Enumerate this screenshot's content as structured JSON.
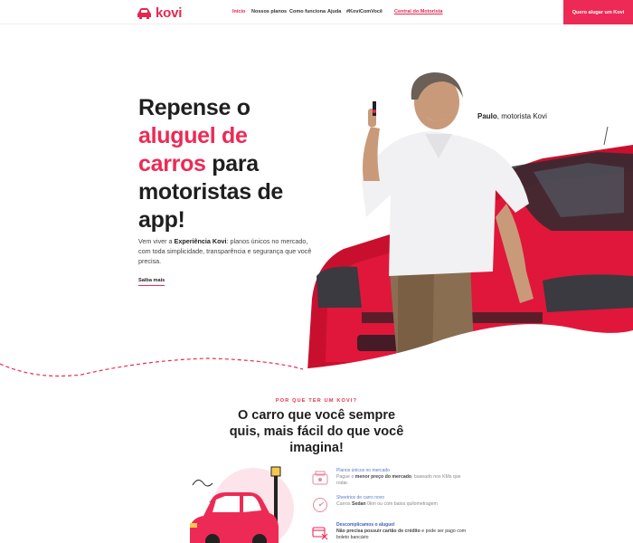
{
  "header": {
    "logo_text": "kovi",
    "nav": {
      "home": "Início",
      "plans": "Nossos planos",
      "how": "Como funciona",
      "help": "Ajuda",
      "hashtag": "#KoviComVocê",
      "central": "Central do Motorista"
    },
    "cta": "Quero alugar um Kovi"
  },
  "hero": {
    "title_line1": "Repense o",
    "title_accent": "aluguel de carros",
    "title_rest": "para motoristas de app!",
    "desc_pre": "Vem viver a ",
    "desc_bold": "Experiência Kovi",
    "desc_post": ": planos únicos no mercado, com toda simplicidade, transparência e segurança que você precisa.",
    "more": "Saiba mais",
    "caption_name": "Paulo",
    "caption_role": ", motorista Kovi"
  },
  "section": {
    "eyebrow": "POR QUE TER UM KOVI?",
    "title": "O carro que você sempre quis, mais fácil do que você imagina!",
    "features": [
      {
        "title": "Planos únicos no mercado",
        "desc_pre": "Pague o ",
        "desc_bold": "menor preço do mercado",
        "desc_post": ", baseado nos KMs que rodar."
      },
      {
        "title": "Sheetrios de carro novo",
        "desc_pre": "Carros ",
        "desc_bold": "Sedan",
        "desc_post": " 0km ou com baixa quilometragem"
      },
      {
        "title": "Descomplicamos o aluguel",
        "desc_pre": "",
        "desc_bold": "Não precisa possuir cartão de crédito",
        "desc_post": " e pode ser pago com boleto bancário"
      }
    ]
  },
  "colors": {
    "brand": "#ed2a55",
    "accent_blue": "#3d5fc4",
    "text_dark": "#1f1f1f"
  }
}
